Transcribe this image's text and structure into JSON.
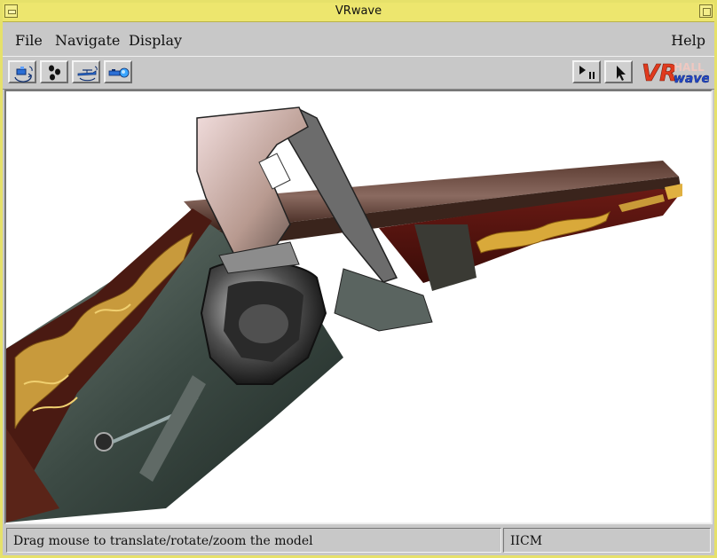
{
  "window": {
    "title": "VRwave"
  },
  "menubar": {
    "items": [
      "File",
      "Navigate",
      "Display"
    ],
    "help": "Help"
  },
  "toolbar": {
    "buttons": [
      {
        "icon": "flip-navigation-icon"
      },
      {
        "icon": "walk-navigation-icon"
      },
      {
        "icon": "fly-navigation-icon"
      },
      {
        "icon": "fly-to-navigation-icon"
      }
    ],
    "right_buttons": [
      {
        "icon": "play-pause-icon"
      },
      {
        "icon": "pointer-arrow-icon"
      }
    ],
    "logo": {
      "main": "VR",
      "sub": "wave",
      "colors": {
        "vr": "#e03a1e",
        "wave": "#2248c8"
      }
    }
  },
  "viewport": {
    "scene": "3d-model-render"
  },
  "statusbar": {
    "message": "Drag mouse to translate/rotate/zoom the model",
    "organization": "IICM"
  }
}
